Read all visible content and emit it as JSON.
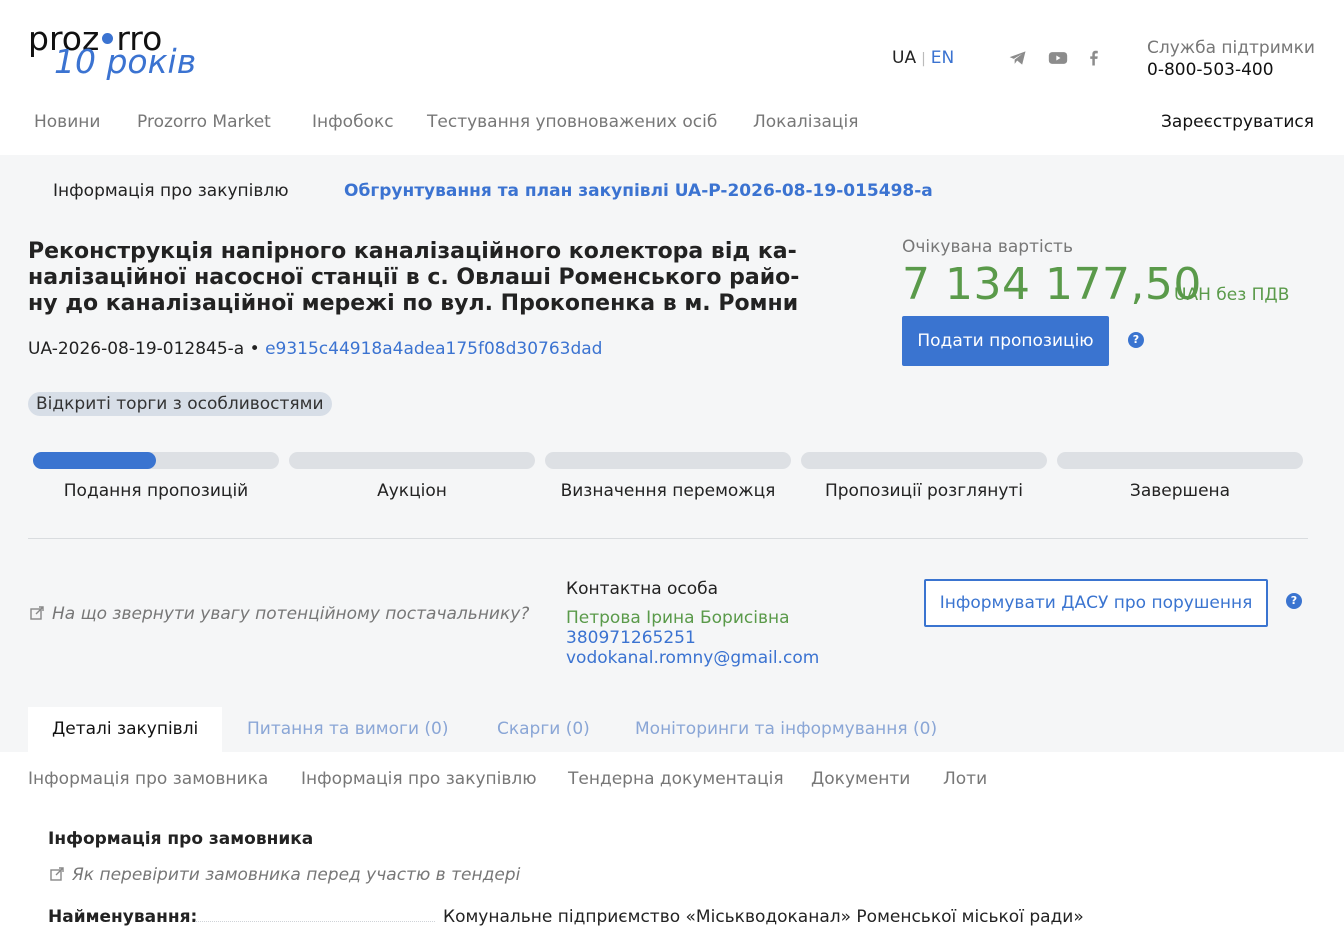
{
  "header": {
    "logo_line1_a": "proz",
    "logo_line1_b": "rro",
    "logo_line2": "10 років",
    "lang_ua": "UA",
    "lang_en": "EN",
    "support_title": "Служба підтримки",
    "support_phone": "0-800-503-400",
    "nav": [
      "Новини",
      "Prozorro Market",
      "Інфобокс",
      "Тестування уповноважених осіб",
      "Локалізація"
    ],
    "register": "Зареєструватися",
    "icons": [
      "telegram-icon",
      "youtube-icon",
      "facebook-icon"
    ]
  },
  "tender": {
    "tab_info": "Інформація про закупівлю",
    "tab_plan": "Обгрунтування та план закупівлі UA-P-2026-08-19-015498-a",
    "title": "Реконструкція напірного каналізаційного колектора від ка­налізаційної насосної станції в с. Овлаші Роменського райо­ну до каналізаційної мережі по вул. Прокопенка в м. Ромни",
    "id": "UA-2026-08-19-012845-a",
    "id_sep": "•",
    "hash": "e9315c44918a4adea175f08d30763dad",
    "procedure": "Відкриті торги з особливостями",
    "expected_label": "Очікувана вартість",
    "expected_value": "7 134 177,50",
    "expected_currency": "UAH без ПДВ",
    "submit_button": "Подати пропозицію",
    "help_mark": "?",
    "stages": [
      {
        "label": "Подання пропозицій",
        "progress": 0.5
      },
      {
        "label": "Аукціон",
        "progress": 0
      },
      {
        "label": "Визначення переможця",
        "progress": 0
      },
      {
        "label": "Пропозиції розглянуті",
        "progress": 0
      },
      {
        "label": "Завершена",
        "progress": 0
      }
    ],
    "attention_link": "На що звернути увагу потенційному постачальнику?",
    "contact_title": "Контактна особа",
    "contact_name": "Петрова Ірина Борисівна",
    "contact_phone": "380971265251",
    "contact_email": "vodokanal.romny@gmail.com",
    "dasu_button": "Інформувати ДАСУ про порушення"
  },
  "tabs": [
    "Деталі закупівлі",
    "Питання та вимоги (0)",
    "Скарги (0)",
    "Моніторинги та інформування (0)"
  ],
  "subnav": [
    "Інформація про замовника",
    "Інформація про закупівлю",
    "Тендерна документація",
    "Документи",
    "Лоти"
  ],
  "customer": {
    "section_title": "Інформація про замовника",
    "hint": "Як перевірити замовника перед участю в тендері",
    "name_label": "Найменування:",
    "name_value": "Комунальне підприємство «Міськводоканал» Роменської міської ради»"
  },
  "colors": {
    "accent": "#3a74d0",
    "price": "#5a9a4a",
    "panel": "#f5f6f7"
  }
}
